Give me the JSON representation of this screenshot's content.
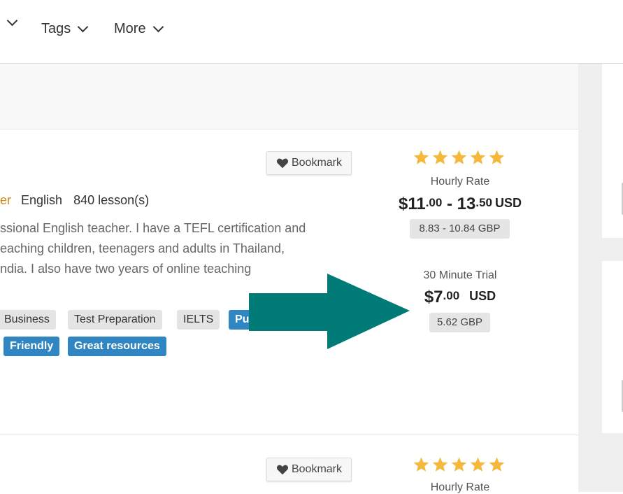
{
  "nav": {
    "items": [
      {
        "label": "",
        "has_chevron": true
      },
      {
        "label": "Tags",
        "has_chevron": true
      },
      {
        "label": "More",
        "has_chevron": true
      }
    ]
  },
  "card1": {
    "bookmark_label": "Bookmark",
    "level_partial": "er",
    "language": "English",
    "lessons": "840 lesson(s)",
    "description": [
      "ssional English teacher. I have a TEFL certification and",
      "eaching children, teenagers and adults in Thailand,",
      "ndia. I also have two years of online teaching"
    ],
    "tags_row1": [
      "Business",
      "Test Preparation",
      "IELTS",
      "Pu"
    ],
    "tags_row2": [
      "Friendly",
      "Great resources"
    ],
    "rating_stars": 5,
    "hourly_label": "Hourly Rate",
    "hourly_price": {
      "low_whole": "$11",
      "low_cents": ".00",
      "sep": " - ",
      "high_whole": "13",
      "high_cents": ".50",
      "currency": "USD"
    },
    "hourly_gbp": "8.83 - 10.84 GBP",
    "trial_label": "30 Minute Trial",
    "trial_price": {
      "whole": "$7",
      "cents": ".00",
      "currency": "USD"
    },
    "trial_gbp": "5.62 GBP"
  },
  "card2": {
    "bookmark_label": "Bookmark",
    "rating_stars": 5,
    "hourly_label": "Hourly Rate"
  },
  "colors": {
    "star": "#f6b83a",
    "tag_blue": "#2f86c3",
    "arrow": "#007b78",
    "level_text": "#d08a15"
  },
  "icons": [
    "chevron-down-icon",
    "heart-icon",
    "star-icon",
    "arrow-right-icon"
  ]
}
